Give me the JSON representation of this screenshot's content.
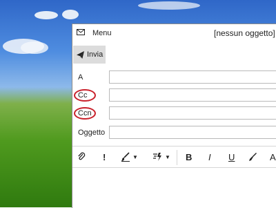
{
  "window": {
    "menu_label": "Menu",
    "subject_title": "[nessun oggetto]",
    "send_label": "Invia"
  },
  "fields": {
    "to_label": "A",
    "cc_label": "Cc",
    "bcc_label": "Ccn",
    "subject_label": "Oggetto"
  },
  "toolbar": {
    "priority": "!",
    "bold": "B",
    "italic": "I",
    "underline": "U",
    "partial_glyph": "A"
  },
  "colors": {
    "annotation_circle": "#c9212b",
    "send_button_bg": "#dcdcdc"
  }
}
